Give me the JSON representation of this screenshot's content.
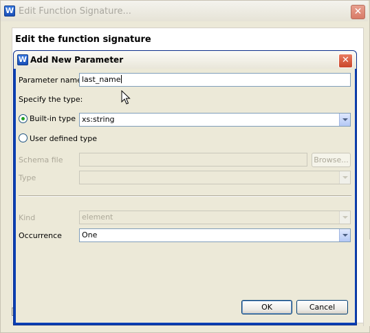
{
  "outer_window": {
    "title": "Edit Function Signature...",
    "heading": "Edit the function signature",
    "app_icon": "app-logo-icon",
    "close_icon": "close-icon"
  },
  "dialog": {
    "title": "Add New Parameter",
    "app_icon": "app-logo-icon",
    "close_icon": "close-icon",
    "parameter_name_label": "Parameter name:",
    "parameter_name_value": "last_name",
    "specify_type_label": "Specify the type:",
    "builtin_type_label": "Built-in type",
    "builtin_type_selected": true,
    "builtin_type_value": "xs:string",
    "user_defined_type_label": "User defined type",
    "user_defined_type_selected": false,
    "schema_file_label": "Schema file",
    "schema_file_value": "",
    "browse_button": "Browse...",
    "type_label": "Type",
    "type_value": "",
    "kind_label": "Kind",
    "kind_value": "element",
    "occurrence_label": "Occurrence",
    "occurrence_value": "One",
    "ok_button": "OK",
    "cancel_button": "Cancel"
  },
  "colors": {
    "dialog_border": "#0a3fb4",
    "field_border": "#7f9db9",
    "window_bg": "#ece9d8",
    "radio_selected": "#21a121"
  }
}
